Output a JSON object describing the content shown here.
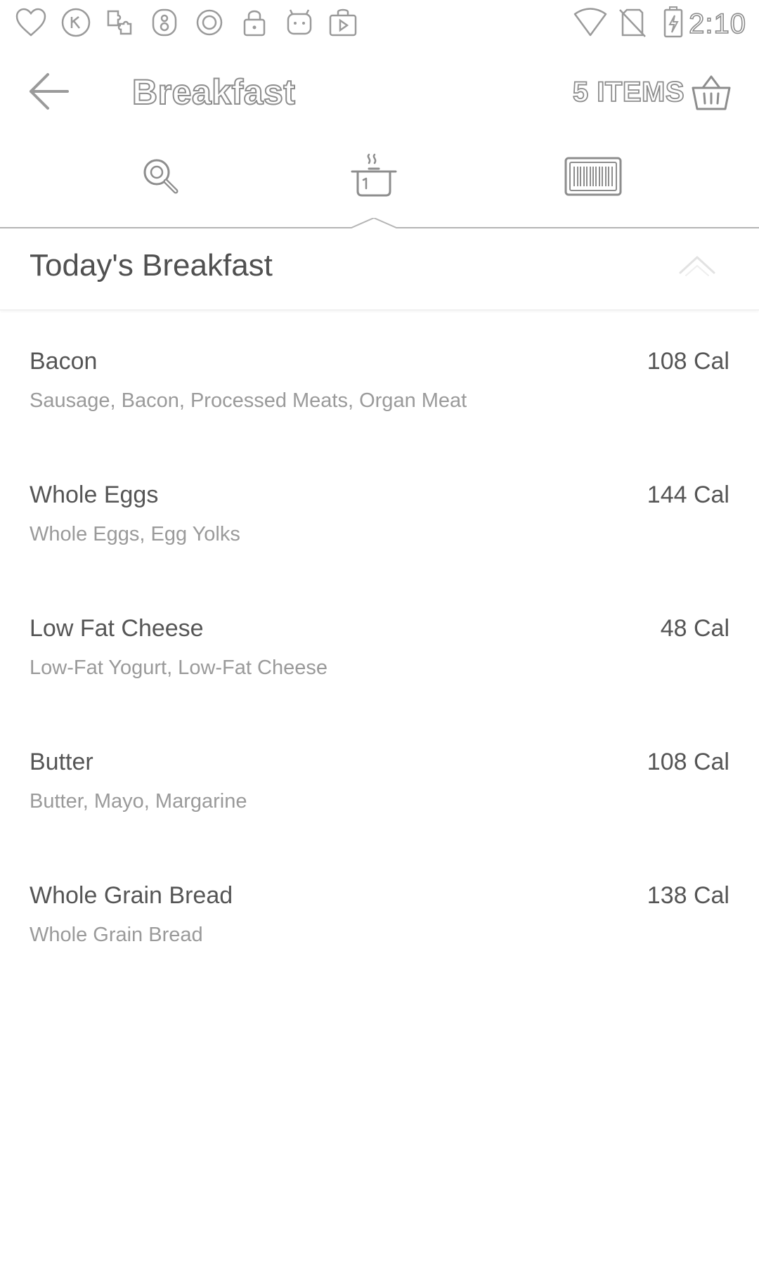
{
  "status_bar": {
    "time": "2:10",
    "left_icons": [
      "heart-icon",
      "kakao-icon",
      "puzzle-icon",
      "notification-badge-icon",
      "record-icon",
      "lock-icon",
      "android-icon",
      "store-icon"
    ],
    "right_icons": [
      "wifi-icon",
      "no-sim-icon",
      "battery-charging-icon"
    ]
  },
  "header": {
    "title": "Breakfast",
    "items_count": "5 ITEMS",
    "back_icon": "arrow-left-icon",
    "basket_icon": "basket-icon"
  },
  "tabs": [
    {
      "id": "search",
      "icon": "search-icon"
    },
    {
      "id": "recipes",
      "icon": "cooking-pot-icon",
      "selected": true
    },
    {
      "id": "barcode",
      "icon": "barcode-icon"
    }
  ],
  "section": {
    "title": "Today's Breakfast",
    "collapse_icon": "chevron-up-icon"
  },
  "foods": [
    {
      "name": "Bacon",
      "calories": "108 Cal",
      "description": "Sausage, Bacon, Processed Meats, Organ Meat"
    },
    {
      "name": "Whole Eggs",
      "calories": "144 Cal",
      "description": "Whole Eggs, Egg Yolks"
    },
    {
      "name": "Low Fat Cheese",
      "calories": "48 Cal",
      "description": "Low-Fat Yogurt, Low-Fat Cheese"
    },
    {
      "name": "Butter",
      "calories": "108 Cal",
      "description": "Butter, Mayo, Margarine"
    },
    {
      "name": "Whole Grain Bread",
      "calories": "138 Cal",
      "description": "Whole Grain Bread"
    }
  ],
  "colors": {
    "outline": "#8d8d8d",
    "text_primary": "#555555",
    "text_secondary": "#9a9a9a",
    "divider": "#b5b5b5"
  }
}
